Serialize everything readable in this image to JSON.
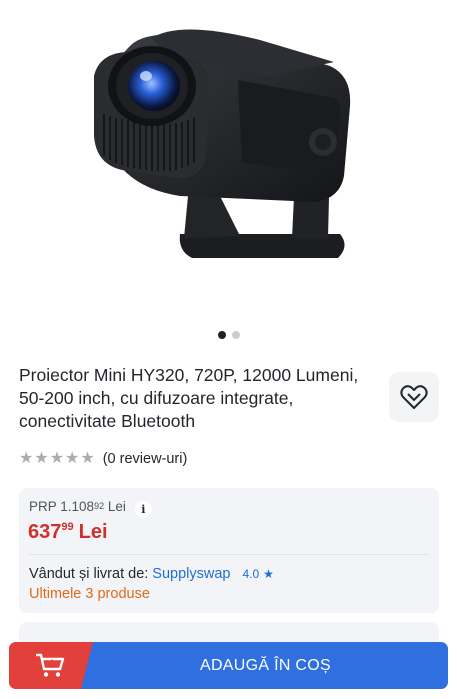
{
  "gallery": {
    "image_alt": "Proiector Mini HY320",
    "dots_total": 2,
    "active_dot": 1
  },
  "product": {
    "title": "Proiector Mini HY320, 720P, 12000 Lumeni, 50-200 inch, cu difuzoare integrate, conectivitate Bluetooth",
    "rating_stars": 0,
    "rating_max": 5,
    "reviews_label": "(0 review-uri)"
  },
  "pricing": {
    "prp_label": "PRP 1.108",
    "prp_decimals": "92",
    "prp_currency": "Lei",
    "info_symbol": "i",
    "price_int": "637",
    "price_dec": "99",
    "price_currency": "Lei"
  },
  "seller": {
    "label": "Vândut și livrat de:",
    "name": "Supplyswap",
    "score": "4.0",
    "stock_text": "Ultimele 3 produse"
  },
  "cart": {
    "button_label": "ADAUGĂ ÎN COȘ"
  },
  "colors": {
    "price_red": "#d0302c",
    "link_blue": "#1f6fd1",
    "stock_orange": "#e06a1b",
    "cart_blue": "#2f6fe0",
    "cart_red": "#e2403a"
  }
}
